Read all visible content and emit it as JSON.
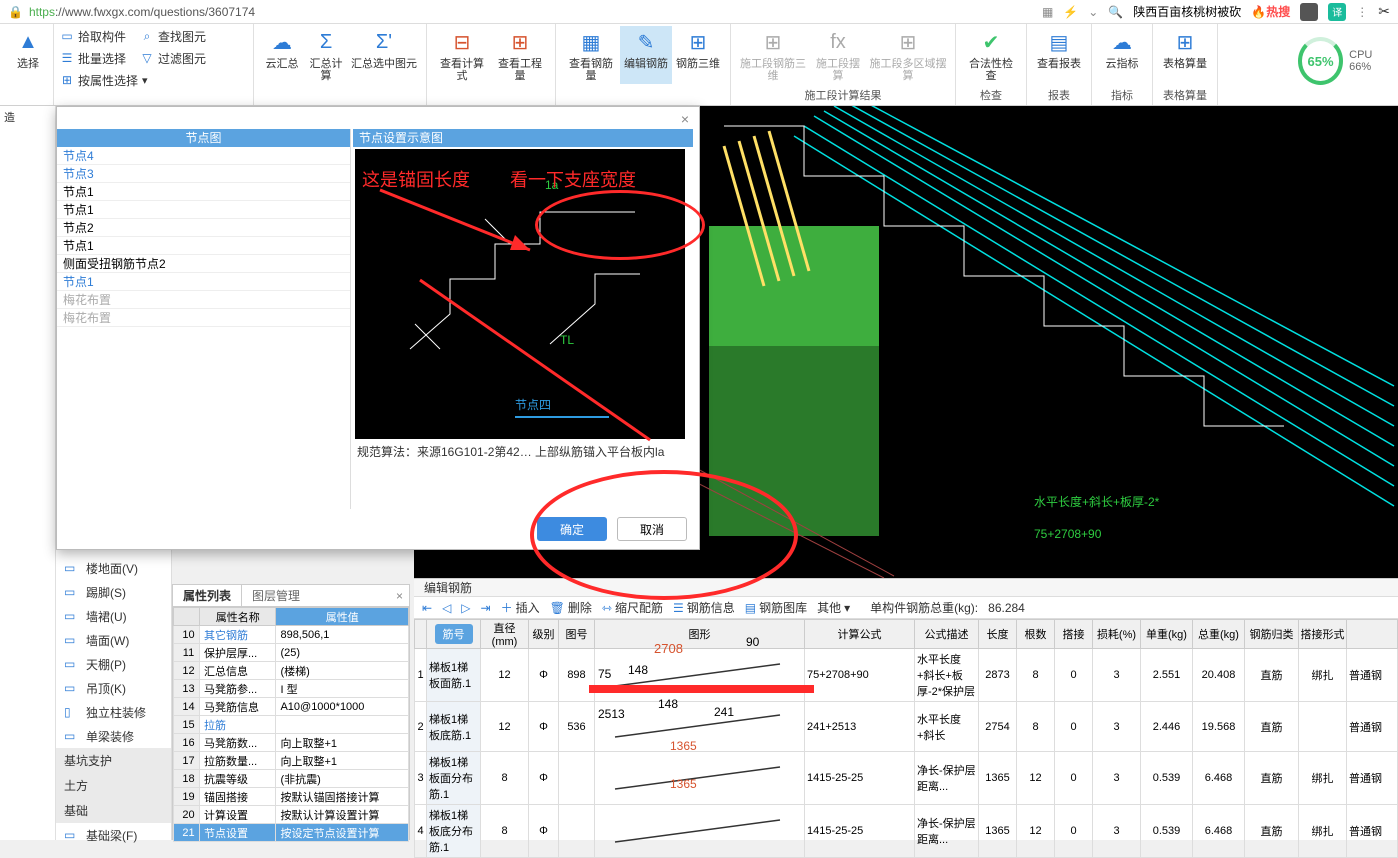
{
  "url": {
    "https": "https",
    "rest": "://www.fwxgx.com/questions/3607174"
  },
  "url_right": {
    "search_text": "陕西百亩核桃树被砍",
    "hot": "热搜",
    "trans": "译"
  },
  "cpu": {
    "percent": "65%",
    "label": "CPU 66%"
  },
  "ribbon": {
    "select": "选择",
    "small": {
      "s1": "拾取构件",
      "s2": "批量选择",
      "s3": "按属性选择",
      "s4": "查找图元",
      "s5": "过滤图元"
    },
    "cloud": {
      "b1": "云汇总",
      "b2": "汇总计算",
      "b3": "汇总选中图元"
    },
    "view": {
      "b1": "查看计算式",
      "b2": "查看工程量"
    },
    "rebar": {
      "b1": "查看钢筋量",
      "b2": "编辑钢筋",
      "b3": "钢筋三维"
    },
    "cons": {
      "b1": "施工段钢筋三维",
      "b2": "施工段摆算",
      "b3": "施工段多区域摆算",
      "label": "施工段计算结果"
    },
    "check": {
      "b1": "合法性检查",
      "label": "检查"
    },
    "report": {
      "b1": "查看报表",
      "label": "报表"
    },
    "index": {
      "b1": "云指标",
      "label": "指标"
    },
    "table": {
      "b1": "表格算量",
      "label": "表格算量"
    }
  },
  "left_tree": {
    "i1": "楼地面(V)",
    "i2": "踢脚(S)",
    "i3": "墙裙(U)",
    "i4": "墙面(W)",
    "i5": "天棚(P)",
    "i6": "吊顶(K)",
    "i7": "独立柱装修",
    "i8": "单梁装修",
    "sec1": "基坑支护",
    "sec2": "土方",
    "sec3": "基础",
    "i9": "基础梁(F)"
  },
  "dialog": {
    "hdr": "节点图",
    "rows": {
      "r1": "节点4",
      "r2": "节点3",
      "r3": "节点1",
      "r4": "节点1",
      "r5": "节点2",
      "r6": "节点1",
      "r7": "侧面受扭钢筋节点2",
      "r8": "节点1",
      "r9": "梅花布置",
      "r10": "梅花布置"
    },
    "title": "节点设置示意图",
    "text_1a": "1a",
    "text_TL": "TL",
    "text_node4": "节点四",
    "spec": "规范算法：来源16G101-2第42…  上部纵筋锚入平台板内la",
    "ok": "确定",
    "cancel": "取消"
  },
  "anno": {
    "t1": "这是锚固长度",
    "t2": "看一下支座宽度"
  },
  "props": {
    "tab1": "属性列表",
    "tab2": "图层管理",
    "hname": "属性名称",
    "hval": "属性值",
    "r10n": "10",
    "r10a": "其它钢筋",
    "r10b": "898,506,1",
    "r11n": "11",
    "r11a": "保护层厚...",
    "r11b": "(25)",
    "r12n": "12",
    "r12a": "汇总信息",
    "r12b": "(楼梯)",
    "r13n": "13",
    "r13a": "马凳筋参...",
    "r13b": "I 型",
    "r14n": "14",
    "r14a": "马凳筋信息",
    "r14b": "A10@1000*1000",
    "r15n": "15",
    "r15a": "拉筋",
    "r15b": "",
    "r16n": "16",
    "r16a": "马凳筋数...",
    "r16b": "向上取整+1",
    "r17n": "17",
    "r17a": "拉筋数量...",
    "r17b": "向上取整+1",
    "r18n": "18",
    "r18a": "抗震等级",
    "r18b": "(非抗震)",
    "r19n": "19",
    "r19a": "锚固搭接",
    "r19b": "按默认锚固搭接计算",
    "r20n": "20",
    "r20a": "计算设置",
    "r20b": "按默认计算设置计算",
    "r21n": "21",
    "r21a": "节点设置",
    "r21b": "按设定节点设置计算"
  },
  "rebar": {
    "hdr": "编辑钢筋",
    "tb": {
      "insert": "插入",
      "delete": "删除",
      "scale": "缩尺配筋",
      "info": "钢筋信息",
      "lib": "钢筋图库",
      "other": "其他",
      "total_lbl": "单构件钢筋总重(kg):",
      "total_val": "86.284"
    },
    "th": {
      "c0": "筋号",
      "c1": "直径(mm)",
      "c2": "级别",
      "c3": "图号",
      "c4": "图形",
      "c5": "计算公式",
      "c6": "公式描述",
      "c7": "长度",
      "c8": "根数",
      "c9": "搭接",
      "c10": "损耗(%)",
      "c11": "单重(kg)",
      "c12": "总重(kg)",
      "c13": "钢筋归类",
      "c14": "搭接形式",
      "c15": ""
    },
    "rows": [
      {
        "idx": "1",
        "name": "梯板1梯板面筋.1",
        "dia": "12",
        "lvl": "Φ",
        "img": "898",
        "formula": "75+2708+90",
        "desc": "水平长度+斜长+板厚-2*保护层",
        "len": "2873",
        "num": "8",
        "lap": "0",
        "loss": "3",
        "uw": "2.551",
        "tw": "20.408",
        "cls": "直筋",
        "join": "绑扎",
        "ext": "普通钢"
      },
      {
        "idx": "2",
        "name": "梯板1梯板底筋.1",
        "dia": "12",
        "lvl": "Φ",
        "img": "536",
        "formula": "241+2513",
        "desc": "水平长度+斜长",
        "len": "2754",
        "num": "8",
        "lap": "0",
        "loss": "3",
        "uw": "2.446",
        "tw": "19.568",
        "cls": "直筋",
        "join": "",
        "ext": "普通钢"
      },
      {
        "idx": "3",
        "name": "梯板1梯板面分布筋.1",
        "dia": "8",
        "lvl": "Φ",
        "img": "",
        "formula": "1415-25-25",
        "desc": "净长-保护层距离...",
        "len": "1365",
        "num": "12",
        "lap": "0",
        "loss": "3",
        "uw": "0.539",
        "tw": "6.468",
        "cls": "直筋",
        "join": "绑扎",
        "ext": "普通钢"
      },
      {
        "idx": "4",
        "name": "梯板1梯板底分布筋.1",
        "dia": "8",
        "lvl": "Φ",
        "img": "",
        "formula": "1415-25-25",
        "desc": "净长-保护层距离...",
        "len": "1365",
        "num": "12",
        "lap": "0",
        "loss": "3",
        "uw": "0.539",
        "tw": "6.468",
        "cls": "直筋",
        "join": "绑扎",
        "ext": "普通钢"
      }
    ],
    "graph": {
      "g1a": "2708",
      "g1b": "90",
      "g1c": "75",
      "g1d": "148",
      "g2a": "2513",
      "g2b": "241",
      "g2c": "148",
      "g3": "1365",
      "g4": "1365"
    }
  },
  "vp_text": {
    "t1": "水平长度+斜长+板厚-2*",
    "t2": "75+2708+90"
  }
}
